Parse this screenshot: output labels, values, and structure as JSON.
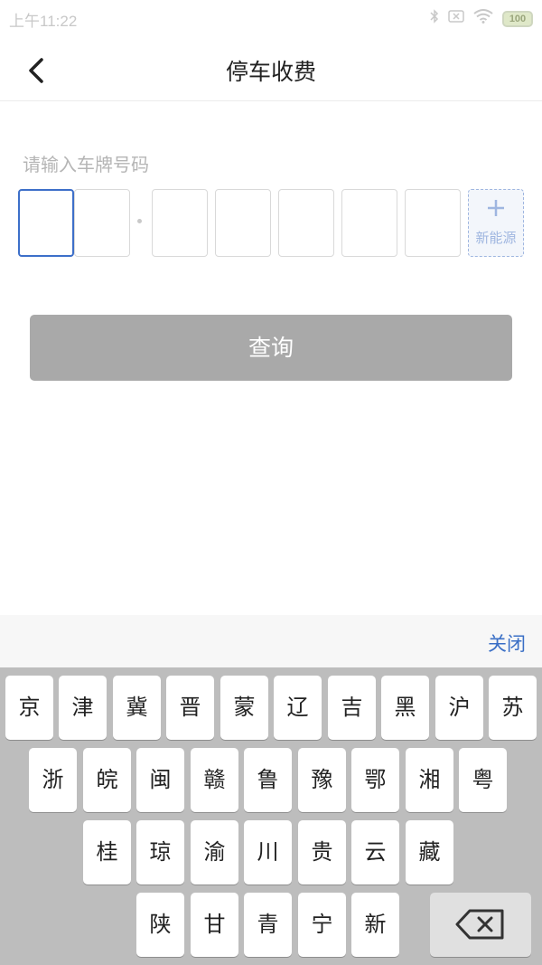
{
  "status_bar": {
    "time": "上午11:22",
    "battery": "100",
    "icons": [
      "bluetooth-icon",
      "sim-off-icon",
      "wifi-icon",
      "battery-icon"
    ]
  },
  "nav": {
    "title": "停车收费",
    "back_icon": "chevron-left-icon"
  },
  "plate": {
    "placeholder_label": "请输入车牌号码",
    "new_energy_label": "新能源",
    "new_energy_icon": "plus-icon",
    "accent_color": "#3d6fc9"
  },
  "query_button": {
    "label": "查询",
    "color": "#a9a9a9"
  },
  "keyboard": {
    "close_label": "关闭",
    "rows": [
      [
        "京",
        "津",
        "冀",
        "晋",
        "蒙",
        "辽",
        "吉",
        "黑",
        "沪",
        "苏"
      ],
      [
        "浙",
        "皖",
        "闽",
        "赣",
        "鲁",
        "豫",
        "鄂",
        "湘",
        "粤"
      ],
      [
        "桂",
        "琼",
        "渝",
        "川",
        "贵",
        "云",
        "藏"
      ],
      [
        "陕",
        "甘",
        "青",
        "宁",
        "新"
      ]
    ],
    "delete_icon": "backspace-icon"
  }
}
